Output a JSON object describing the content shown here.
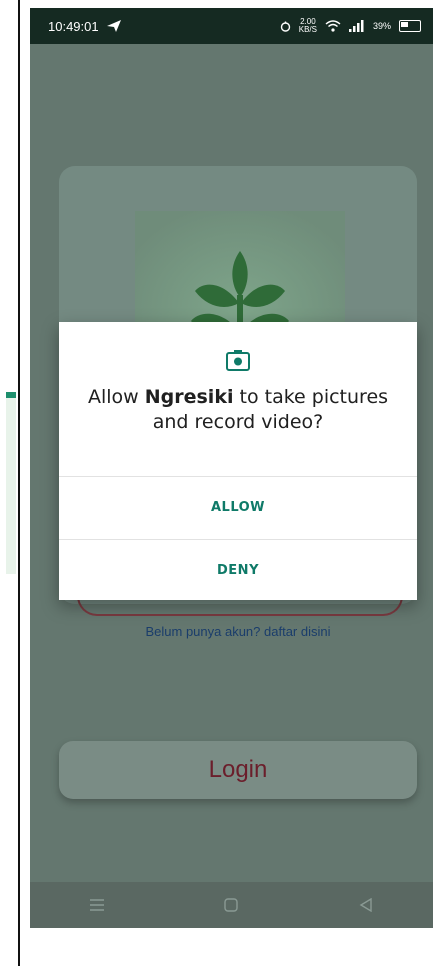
{
  "status_bar": {
    "time": "10:49:01",
    "net_speed_value": "2.00",
    "net_speed_unit": "KB/S",
    "battery": "39%"
  },
  "dialog": {
    "message_prefix": "Allow ",
    "app_name": "Ngresiki",
    "message_suffix": " to take pictures and record video?",
    "allow_label": "ALLOW",
    "deny_label": "DENY"
  },
  "login_card": {
    "register_link": "Belum punya akun? daftar disini"
  },
  "login_button": {
    "label": "Login"
  },
  "colors": {
    "dialog_accent": "#0f7a68",
    "login_text": "#6b1e2b",
    "scrim_background": "#64776f"
  },
  "icons": {
    "status_left": "send-icon",
    "dialog": "camera-icon",
    "nav": [
      "menu-icon",
      "home-icon",
      "back-icon"
    ]
  }
}
